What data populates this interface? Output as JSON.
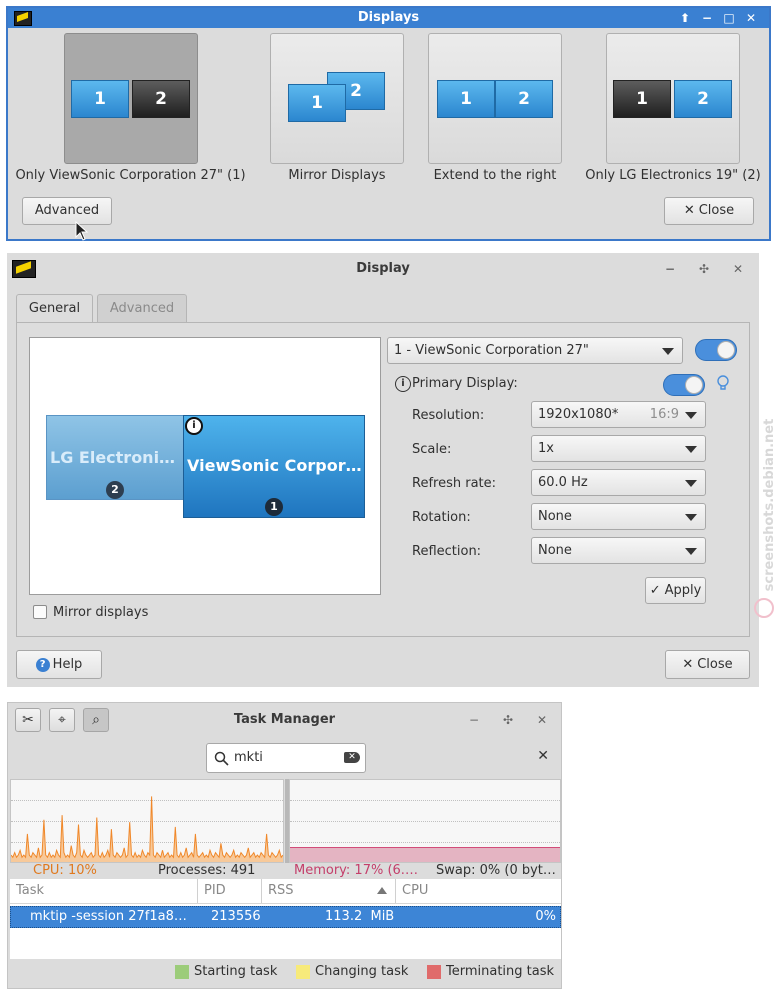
{
  "displays_dialog": {
    "title": "Displays",
    "options": [
      {
        "label": "Only ViewSonic Corporation 27\" (1)",
        "mon1": "1",
        "mon2": "2"
      },
      {
        "label": "Mirror Displays",
        "mon1": "1",
        "mon2": "2"
      },
      {
        "label": "Extend to the right",
        "mon1": "1",
        "mon2": "2"
      },
      {
        "label": "Only LG Electronics 19\" (2)",
        "mon1": "1",
        "mon2": "2"
      }
    ],
    "advanced_label": "Advanced",
    "close_label": "Close",
    "close_glyph": "✕"
  },
  "display_settings": {
    "title": "Display",
    "tabs": [
      "General",
      "Advanced"
    ],
    "monitor_lg_label": "LG Electroni…",
    "monitor_lg_badge": "2",
    "monitor_vs_label": "ViewSonic Corpor…",
    "monitor_vs_badge": "1",
    "primary_marker": "i",
    "mirror_label": "Mirror displays",
    "output_select": "1 - ViewSonic Corporation 27\"",
    "primary_label": "Primary Display:",
    "fields": [
      {
        "label": "Resolution:",
        "value": "1920x1080*",
        "hint": "16:9"
      },
      {
        "label": "Scale:",
        "value": "1x",
        "hint": ""
      },
      {
        "label": "Refresh rate:",
        "value": "60.0 Hz",
        "hint": ""
      },
      {
        "label": "Rotation:",
        "value": "None",
        "hint": ""
      },
      {
        "label": "Reflection:",
        "value": "None",
        "hint": ""
      }
    ],
    "apply_label": "Apply",
    "help_label": "Help",
    "close_label": "Close"
  },
  "task_manager": {
    "title": "Task Manager",
    "search_value": "mkti",
    "cpu_label": "CPU: 10%",
    "processes_label": "Processes: 491",
    "memory_label": "Memory: 17% (6.…",
    "swap_label": "Swap: 0% (0 byt…",
    "columns": [
      "Task",
      "PID",
      "RSS",
      "CPU"
    ],
    "rows": [
      {
        "task": "mktip -session 27f1a8…",
        "pid": "213556",
        "rss": "113.2  MiB",
        "cpu": "0%"
      }
    ],
    "legend": [
      {
        "label": "Starting task",
        "color": "#9ccc7a"
      },
      {
        "label": "Changing task",
        "color": "#f7ea7a"
      },
      {
        "label": "Terminating task",
        "color": "#e06b6b"
      }
    ],
    "cpu_history_percent": [
      3,
      2,
      4,
      2,
      3,
      5,
      2,
      3,
      2,
      12,
      3,
      2,
      4,
      3,
      2,
      6,
      2,
      3,
      18,
      3,
      2,
      4,
      2,
      3,
      2,
      5,
      3,
      2,
      20,
      4,
      2,
      3,
      2,
      7,
      3,
      2,
      4,
      16,
      3,
      2,
      5,
      3,
      2,
      3,
      4,
      2,
      3,
      19,
      3,
      2,
      4,
      2,
      3,
      5,
      2,
      14,
      3,
      2,
      4,
      3,
      2,
      3,
      6,
      2,
      3,
      17,
      3,
      2,
      4,
      2,
      3,
      2,
      5,
      3,
      2,
      4,
      3,
      28,
      3,
      2,
      4,
      3,
      2,
      5,
      2,
      3,
      4,
      2,
      3,
      2,
      15,
      3,
      2,
      4,
      2,
      3,
      6,
      2,
      3,
      4,
      2,
      12,
      3,
      2,
      3,
      4,
      2,
      3,
      2,
      5,
      3,
      2,
      4,
      3,
      2,
      8,
      3,
      2,
      4,
      3,
      2,
      3,
      5,
      2,
      3,
      2,
      4,
      3,
      2,
      3,
      6,
      2,
      3,
      4,
      2,
      3,
      2,
      4,
      3,
      2,
      12,
      3,
      2,
      4,
      3,
      2,
      3,
      5,
      2,
      3
    ],
    "memory_percent": 17
  },
  "watermark": "screenshots.debian.net",
  "colors": {
    "accent": "#3a80d2",
    "selection": "#3d85d6",
    "cpu": "#f0882a",
    "memory": "#d24b78"
  }
}
